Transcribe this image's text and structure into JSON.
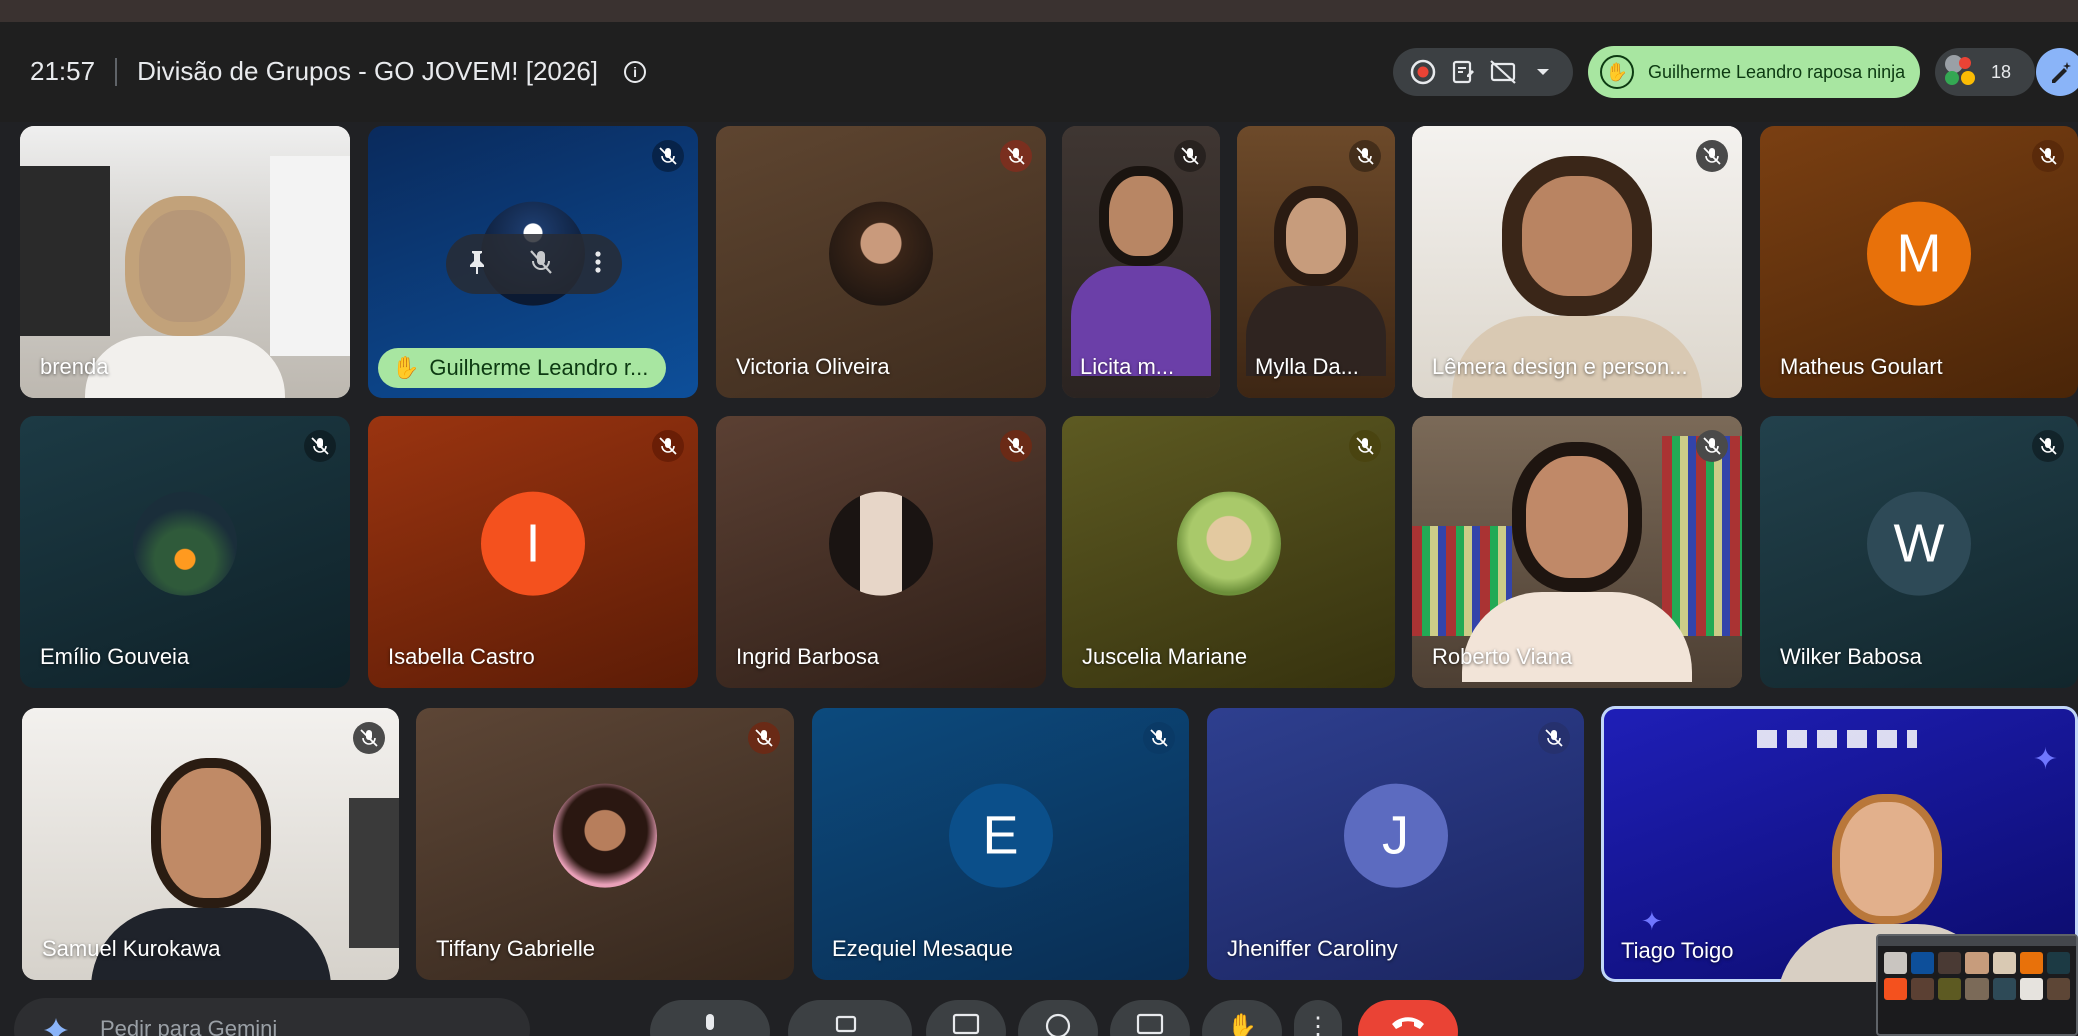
{
  "meeting": {
    "time": "21:57",
    "title": "Divisão de Grupos - GO JOVEM! [2026]"
  },
  "hand_raise": {
    "name": "Guilherme Leandro raposa ninja"
  },
  "people": {
    "count": "18"
  },
  "tiles": [
    {
      "name": "brenda",
      "kind": "camera",
      "muted": false
    },
    {
      "name": "Guilherme Leandro r...",
      "kind": "hand",
      "muted": true
    },
    {
      "name": "Victoria Oliveira",
      "kind": "photo",
      "muted": true
    },
    {
      "name": "Licita m...",
      "kind": "camera",
      "muted": true
    },
    {
      "name": "Mylla Da...",
      "kind": "camera",
      "muted": true
    },
    {
      "name": "Lêmera design e person...",
      "kind": "camera",
      "muted": true
    },
    {
      "name": "Matheus Goulart",
      "kind": "letter",
      "letter": "M",
      "muted": true
    },
    {
      "name": "Emílio Gouveia",
      "kind": "photo",
      "muted": true
    },
    {
      "name": "Isabella Castro",
      "kind": "letter",
      "letter": "I",
      "muted": true
    },
    {
      "name": "Ingrid Barbosa",
      "kind": "photo",
      "muted": true
    },
    {
      "name": "Juscelia Mariane",
      "kind": "photo",
      "muted": true
    },
    {
      "name": "Roberto Viana",
      "kind": "camera",
      "muted": true
    },
    {
      "name": "Wilker Babosa",
      "kind": "letter",
      "letter": "W",
      "muted": true
    },
    {
      "name": "Samuel Kurokawa",
      "kind": "camera",
      "muted": true
    },
    {
      "name": "Tiffany Gabrielle",
      "kind": "photo",
      "muted": true
    },
    {
      "name": "Ezequiel Mesaque",
      "kind": "letter",
      "letter": "E",
      "muted": true
    },
    {
      "name": "Jheniffer Caroliny",
      "kind": "letter",
      "letter": "J",
      "muted": true
    },
    {
      "name": "Tiago Toigo",
      "kind": "camera",
      "muted": false
    }
  ],
  "colors": {
    "accent_green": "#a8e6a1",
    "avatar_m": "#e8710a",
    "avatar_i": "#f4511e",
    "avatar_e": "#0b4f8a",
    "avatar_j": "#5c6bc0",
    "avatar_w": "#2e4a57",
    "end_call": "#ea4335"
  },
  "gemini": {
    "placeholder": "Pedir para Gemini"
  }
}
